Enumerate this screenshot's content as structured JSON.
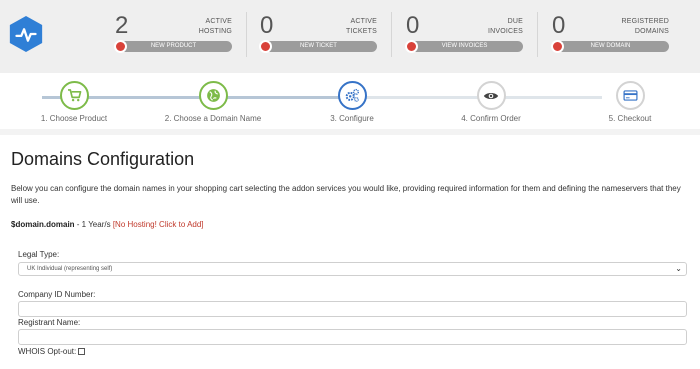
{
  "stats": [
    {
      "count": "2",
      "label_line1": "ACTIVE",
      "label_line2": "HOSTING",
      "button": "NEW PRODUCT",
      "icon": "cart-icon"
    },
    {
      "count": "0",
      "label_line1": "ACTIVE",
      "label_line2": "TICKETS",
      "button": "NEW TICKET",
      "icon": "comment-icon"
    },
    {
      "count": "0",
      "label_line1": "DUE",
      "label_line2": "INVOICES",
      "button": "VIEW INVOICES",
      "icon": "invoice-icon"
    },
    {
      "count": "0",
      "label_line1": "REGISTERED",
      "label_line2": "DOMAINS",
      "button": "NEW DOMAIN",
      "icon": "globe-icon"
    }
  ],
  "steps": [
    {
      "label": "1. Choose Product",
      "icon": "cart-icon",
      "state": "done"
    },
    {
      "label": "2. Choose a Domain Name",
      "icon": "globe-icon",
      "state": "done"
    },
    {
      "label": "3. Configure",
      "icon": "gears-icon",
      "state": "active"
    },
    {
      "label": "4. Confirm Order",
      "icon": "eye-icon",
      "state": "pending"
    },
    {
      "label": "5. Checkout",
      "icon": "credit-card-icon",
      "state": "pending"
    }
  ],
  "page": {
    "title": "Domains Configuration",
    "intro": "Below you can configure the domain names in your shopping cart selecting the addon services you would like, providing required information for them and defining the nameservers that they will use."
  },
  "domain": {
    "name": "$domain.domain",
    "term": " - 1 Year/s ",
    "hosting_link": "[No Hosting! Click to Add]"
  },
  "form": {
    "legal_type_label": "Legal Type:",
    "legal_type_value": "UK Individual (representing self)",
    "company_id_label": "Company ID Number:",
    "company_id_value": "",
    "registrant_label": "Registrant Name:",
    "registrant_value": "",
    "whois_label": "WHOIS Opt-out:"
  },
  "colors": {
    "accent_blue": "#3673c7",
    "done_green": "#7dbb49",
    "badge_red": "#d9423a",
    "link_red": "#c0392b"
  }
}
